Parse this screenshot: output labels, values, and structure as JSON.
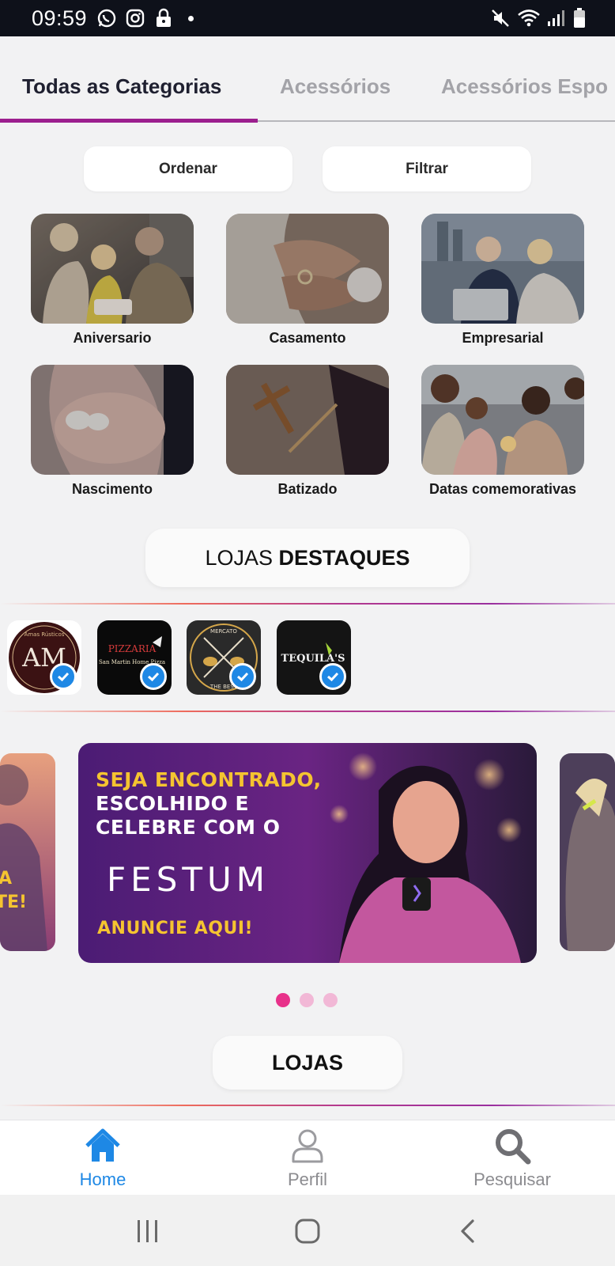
{
  "status_bar": {
    "time": "09:59",
    "left_icons": [
      "whatsapp-icon",
      "instagram-icon",
      "lock-icon",
      "dot-icon"
    ],
    "right_icons": [
      "mute-icon",
      "wifi-icon",
      "signal-icon",
      "battery-icon"
    ]
  },
  "tabs": [
    {
      "label": "Todas as Categorias",
      "active": true
    },
    {
      "label": "Acessórios",
      "active": false
    },
    {
      "label": "Acessórios Espo",
      "active": false
    }
  ],
  "toolbar": {
    "sort_label": "Ordenar",
    "filter_label": "Filtrar"
  },
  "categories": [
    {
      "label": "Aniversario"
    },
    {
      "label": "Casamento"
    },
    {
      "label": "Empresarial"
    },
    {
      "label": "Nascimento"
    },
    {
      "label": "Batizado"
    },
    {
      "label": "Datas comemorativas"
    }
  ],
  "featured_section": {
    "title_light": "LOJAS ",
    "title_bold": "DESTAQUES"
  },
  "featured_stores": [
    {
      "logo_text": "AM",
      "logo_subtext": "Amas Rústicos",
      "verified": true
    },
    {
      "logo_text": "PIZZARIA",
      "logo_subtext": "San Martin Home Pizza",
      "verified": true
    },
    {
      "logo_text": "MERCATO",
      "logo_subtext": "THE BEST",
      "verified": true
    },
    {
      "logo_text": "TEQUILA'S",
      "logo_subtext": "",
      "verified": true
    }
  ],
  "banner": {
    "line1": "SEJA ENCONTRADO,",
    "line2": "ESCOLHIDO E",
    "line3": "CELEBRE COM O",
    "brand": "FESTUM",
    "cta": "ANUNCIE AQUI!",
    "left_peek_text_1": "A",
    "left_peek_text_2": "TE!",
    "active_index": 0,
    "count": 3
  },
  "stores_section": {
    "title": "LOJAS"
  },
  "bottom_nav": [
    {
      "label": "Home",
      "icon": "home-icon",
      "active": true
    },
    {
      "label": "Perfil",
      "icon": "user-icon",
      "active": false
    },
    {
      "label": "Pesquisar",
      "icon": "search-icon",
      "active": false
    }
  ],
  "colors": {
    "accent_purple": "#9c1f8e",
    "active_blue": "#1e88e5",
    "dot_pink": "#e8318a",
    "banner_yellow": "#f5c430"
  }
}
